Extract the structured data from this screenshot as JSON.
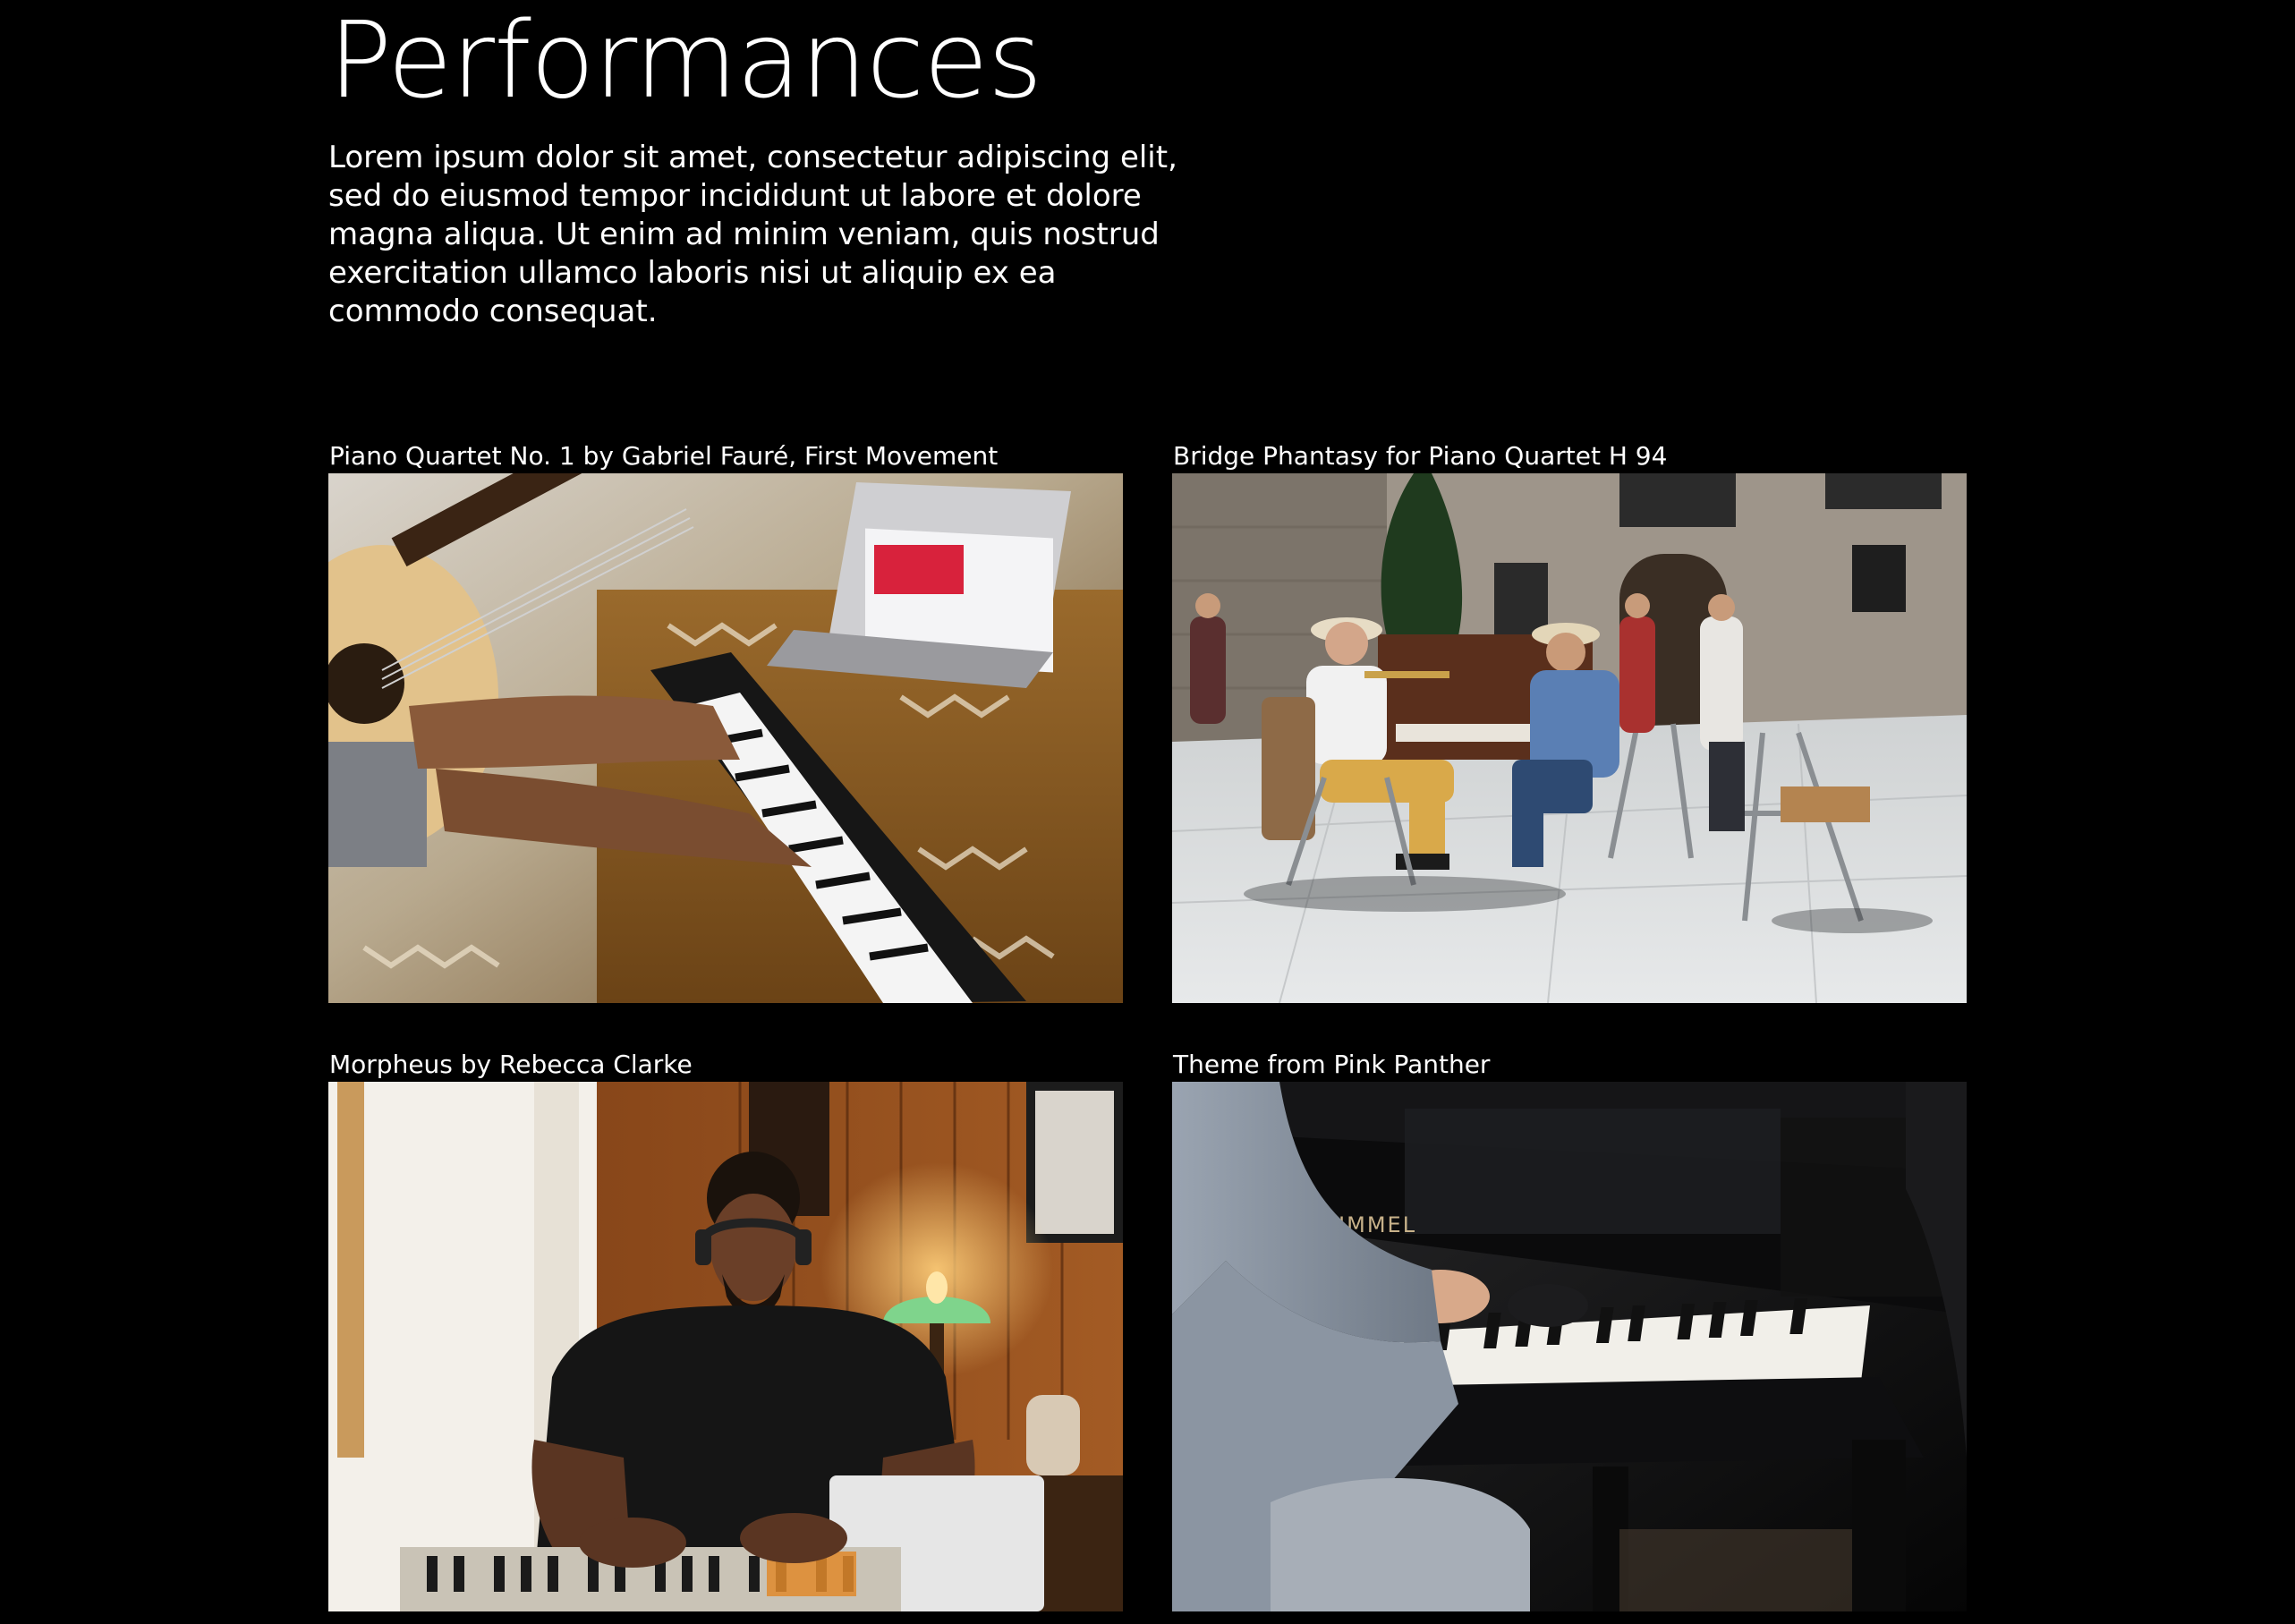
{
  "page": {
    "title": "Performances",
    "intro": "Lorem ipsum dolor sit amet, consectetur adipiscing elit, sed do eiusmod tempor incididunt ut labore et dolore magna aliqua. Ut enim ad minim veniam, quis nostrud exercitation ullamco laboris nisi ut aliquip ex ea commodo consequat."
  },
  "performances": [
    {
      "title": "Piano Quartet No. 1 by Gabriel Fauré, First Movement",
      "photo": "keyboard-and-guitar-photo"
    },
    {
      "title": "Bridge Phantasy for Piano Quartet H 94",
      "photo": "street-musicians-photo"
    },
    {
      "title": "Morpheus by Rebecca Clarke",
      "photo": "musician-with-headphones-photo"
    },
    {
      "title": "Theme from Pink Panther",
      "photo": "grand-piano-photo",
      "piano_brand": "SCHIMMEL"
    }
  ],
  "colors": {
    "background": "#000000",
    "text": "#ffffff"
  }
}
